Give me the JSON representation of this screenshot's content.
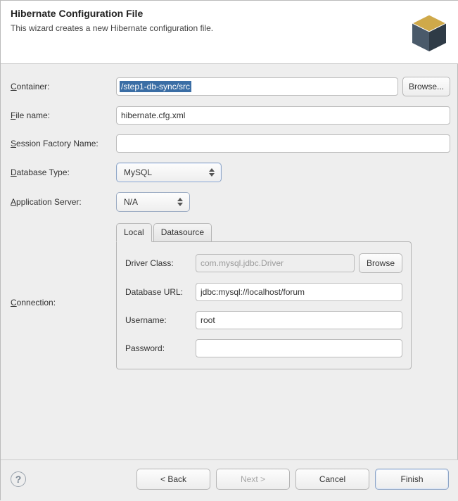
{
  "header": {
    "title": "Hibernate Configuration File",
    "subtitle": "This wizard creates a new Hibernate configuration file."
  },
  "labels": {
    "container": "Container:",
    "file_name": "File name:",
    "session_factory": "Session Factory Name:",
    "database_type": "Database Type:",
    "application_server": "Application Server:",
    "connection": "Connection:",
    "browse": "Browse...",
    "browse_short": "Browse"
  },
  "fields": {
    "container": "/step1-db-sync/src",
    "file_name": "hibernate.cfg.xml",
    "session_factory": "",
    "database_type": "MySQL",
    "application_server": "N/A"
  },
  "tabs": {
    "local": "Local",
    "datasource": "Datasource"
  },
  "conn": {
    "driver_class_label": "Driver Class:",
    "driver_class": "com.mysql.jdbc.Driver",
    "database_url_label": "Database URL:",
    "database_url": "jdbc:mysql://localhost/forum",
    "username_label": "Username:",
    "username": "root",
    "password_label": "Password:",
    "password": ""
  },
  "footer": {
    "back": "< Back",
    "next": "Next >",
    "cancel": "Cancel",
    "finish": "Finish"
  }
}
